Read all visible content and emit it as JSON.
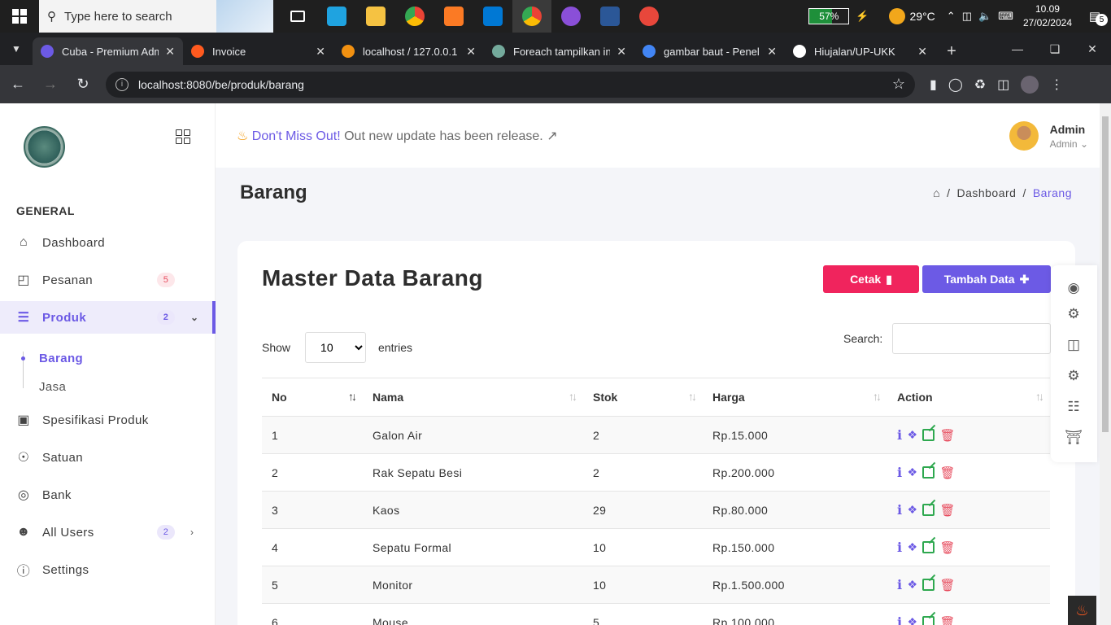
{
  "taskbar": {
    "search_placeholder": "Type here to search",
    "battery": "57%",
    "temperature": "29°C",
    "time": "10.09",
    "date": "27/02/2024",
    "notifications": "5"
  },
  "browser": {
    "tabs": [
      {
        "title": "Cuba - Premium Adm",
        "favicon_color": "#6c5ae5"
      },
      {
        "title": "Invoice",
        "favicon_color": "#ff5a1f"
      },
      {
        "title": "localhost / 127.0.0.1 /",
        "favicon_color": "#f29111"
      },
      {
        "title": "Foreach tampilkan in",
        "favicon_color": "#74aa9c"
      },
      {
        "title": "gambar baut - Penel",
        "favicon_color": "#4285f4"
      },
      {
        "title": "Hiujalan/UP-UKK",
        "favicon_color": "#ffffff"
      }
    ],
    "url": "localhost:8080/be/produk/barang"
  },
  "sidebar": {
    "section": "GENERAL",
    "items": [
      {
        "label": "Dashboard"
      },
      {
        "label": "Pesanan",
        "badge": "5"
      },
      {
        "label": "Produk",
        "badge": "2"
      },
      {
        "label": "Spesifikasi Produk"
      },
      {
        "label": "Satuan"
      },
      {
        "label": "Bank"
      },
      {
        "label": "All Users",
        "badge": "2"
      },
      {
        "label": "Settings"
      }
    ],
    "sub_items": [
      {
        "label": "Barang"
      },
      {
        "label": "Jasa"
      }
    ]
  },
  "header": {
    "announce_highlight": "Don't Miss Out!",
    "announce_text": "Out new update has been release.",
    "user_name": "Admin",
    "user_role": "Admin"
  },
  "page": {
    "title": "Barang",
    "breadcrumb": [
      "Dashboard",
      "Barang"
    ]
  },
  "card": {
    "title": "Master Data Barang",
    "cetak_label": "Cetak",
    "tambah_label": "Tambah Data",
    "show_label": "Show",
    "entries_label": "entries",
    "entries_value": "10",
    "search_label": "Search:"
  },
  "table": {
    "columns": [
      "No",
      "Nama",
      "Stok",
      "Harga",
      "Action"
    ],
    "rows": [
      [
        "1",
        "Galon Air",
        "2",
        "Rp.15.000"
      ],
      [
        "2",
        "Rak Sepatu Besi",
        "2",
        "Rp.200.000"
      ],
      [
        "3",
        "Kaos",
        "29",
        "Rp.80.000"
      ],
      [
        "4",
        "Sepatu Formal",
        "10",
        "Rp.150.000"
      ],
      [
        "5",
        "Monitor",
        "10",
        "Rp.1.500.000"
      ],
      [
        "6",
        "Mouse",
        "5",
        "Rp.100.000"
      ]
    ]
  },
  "colors": {
    "accent": "#6c5ae5",
    "danger": "#f0245d",
    "success": "#2ea84f"
  }
}
